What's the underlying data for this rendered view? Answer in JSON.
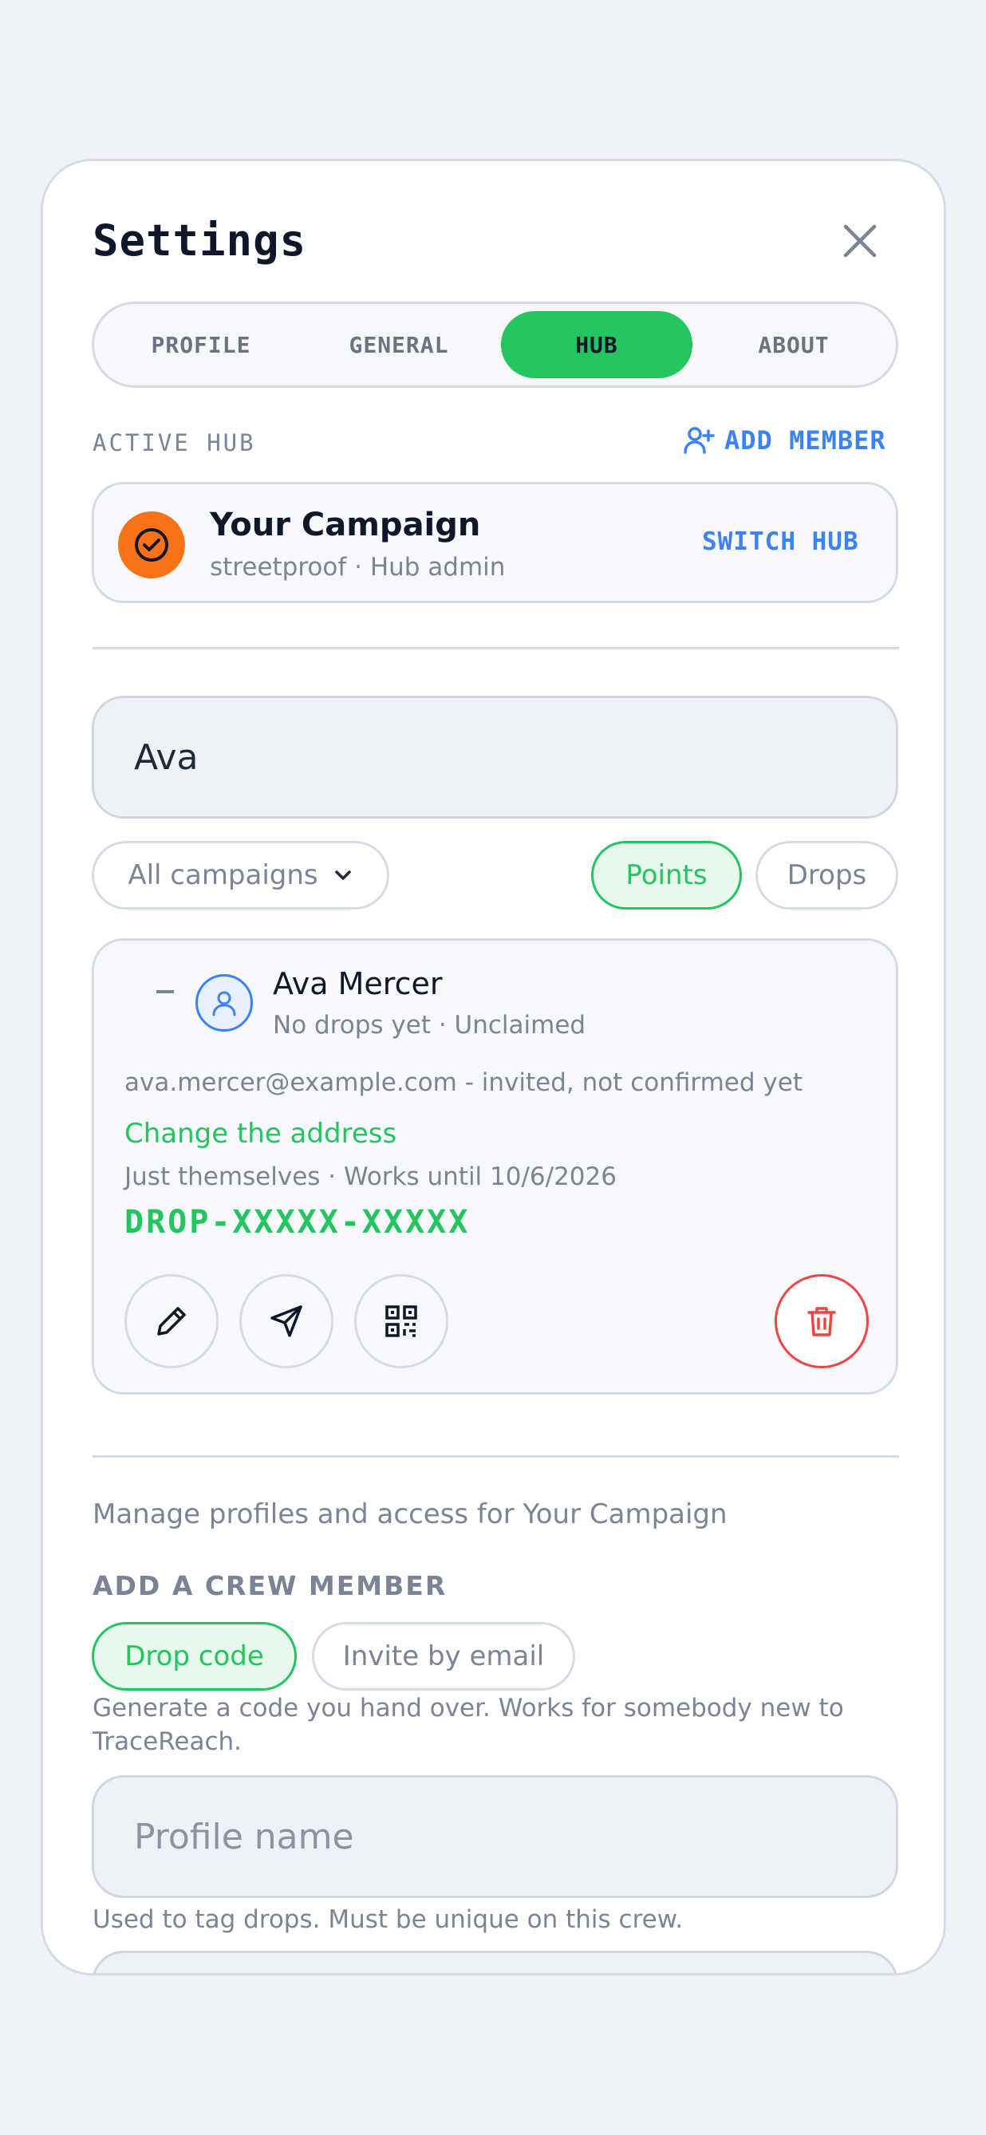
{
  "settings": {
    "title": "Settings",
    "tabs": [
      {
        "label": "PROFILE"
      },
      {
        "label": "GENERAL"
      },
      {
        "label": "HUB",
        "active": true
      },
      {
        "label": "ABOUT"
      }
    ]
  },
  "hub": {
    "section_label": "ACTIVE HUB",
    "add_member_label": "ADD MEMBER",
    "name": "Your Campaign",
    "subtitle": "streetproof · Hub admin",
    "switch_label": "SWITCH HUB",
    "avatar_color": "#f97316"
  },
  "search": {
    "value": "Ava"
  },
  "filters": {
    "campaign_select": "All campaigns",
    "points_label": "Points",
    "drops_label": "Drops"
  },
  "member": {
    "collapse_marker": "–",
    "name": "Ava Mercer",
    "status": "No drops yet · Unclaimed",
    "email_line": "ava.mercer@example.com - invited, not confirmed yet",
    "change_address_label": "Change the address",
    "detail": "Just themselves · Works until 10/6/2026",
    "code": "DROP-XXXXX-XXXXX",
    "actions": [
      "pencil-icon",
      "send-icon",
      "qr-code-icon",
      "trash-icon"
    ]
  },
  "manage": {
    "description": "Manage profiles and access for Your Campaign",
    "add_crew_label": "ADD A CREW MEMBER",
    "mode_drop_code": "Drop code",
    "mode_invite_email": "Invite by email",
    "mode_helper": "Generate a code you hand over. Works for somebody new to TraceReach.",
    "profile_name_placeholder": "Profile name",
    "profile_name_helper": "Used to tag drops. Must be unique on this crew."
  },
  "colors": {
    "accent_green": "#22c55e",
    "accent_blue": "#3b82f6",
    "danger_red": "#ef4444",
    "border": "#d5dbe6",
    "background": "#eff2f7"
  }
}
